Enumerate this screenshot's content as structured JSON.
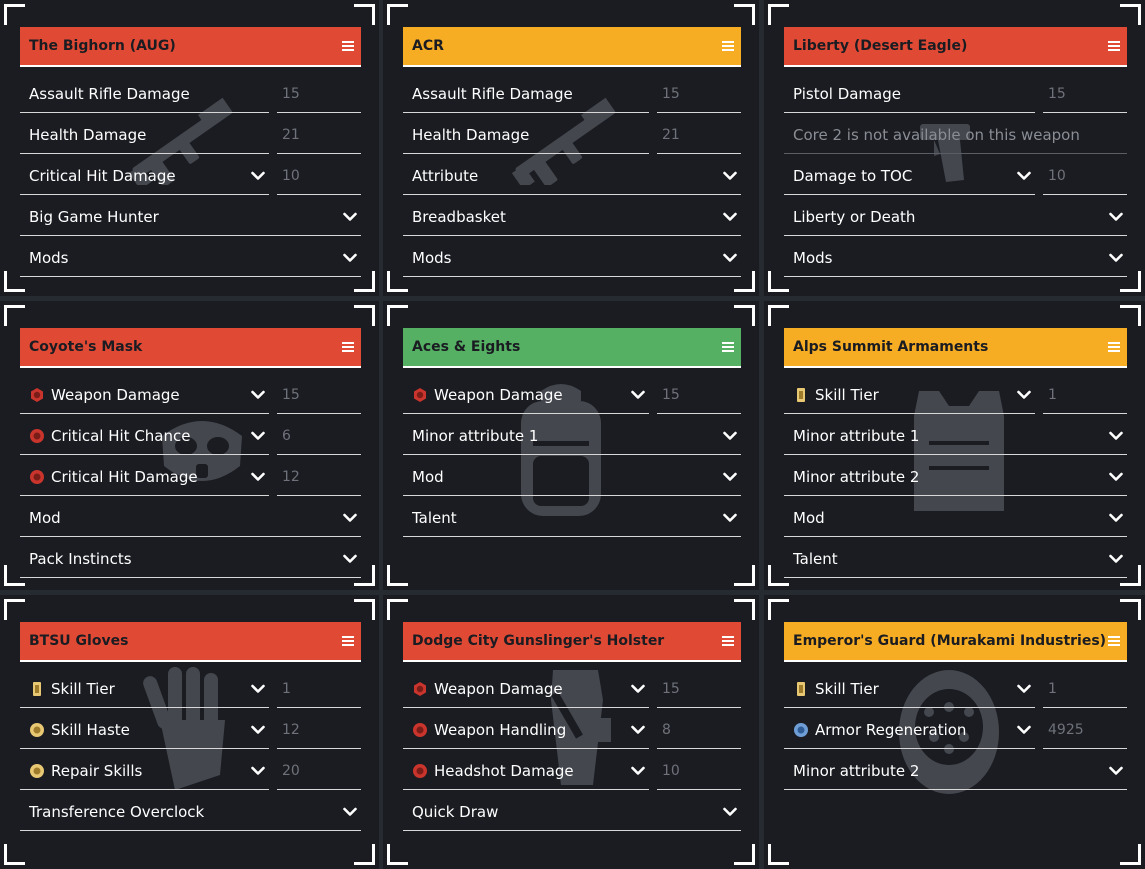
{
  "colors": {
    "red": "#e04a35",
    "yellow": "#f7ad23",
    "green": "#55b063",
    "panel": "#1a1c22",
    "background": "#262a31"
  },
  "panels": [
    {
      "title": "The Bighorn (AUG)",
      "color": "red",
      "watermark": "rifle-icon",
      "rows": [
        {
          "label": "Assault Rifle Damage",
          "value": "15"
        },
        {
          "label": "Health Damage",
          "value": "21"
        },
        {
          "label": "Critical Hit Damage",
          "value": "10",
          "dropdown": true
        },
        {
          "label": "Big Game Hunter",
          "dropdown": true
        },
        {
          "label": "Mods",
          "dropdown": true
        }
      ]
    },
    {
      "title": "ACR",
      "color": "yellow",
      "watermark": "rifle-icon",
      "rows": [
        {
          "label": "Assault Rifle Damage",
          "value": "15"
        },
        {
          "label": "Health Damage",
          "value": "21"
        },
        {
          "label": "Attribute",
          "dropdown": true
        },
        {
          "label": "Breadbasket",
          "dropdown": true
        },
        {
          "label": "Mods",
          "dropdown": true
        }
      ]
    },
    {
      "title": "Liberty (Desert Eagle)",
      "color": "red",
      "watermark": "pistol-icon",
      "rows": [
        {
          "label": "Pistol Damage",
          "value": "15"
        },
        {
          "label": "Core 2 is not available on this weapon",
          "disabled": true
        },
        {
          "label": "Damage to TOC",
          "value": "10",
          "dropdown": true
        },
        {
          "label": "Liberty or Death",
          "dropdown": true
        },
        {
          "label": "Mods",
          "dropdown": true
        }
      ]
    },
    {
      "title": "Coyote's Mask",
      "color": "red",
      "watermark": "mask-icon",
      "rows": [
        {
          "label": "Weapon Damage",
          "value": "15",
          "dropdown": true,
          "icon": "offense-core-icon"
        },
        {
          "label": "Critical Hit Chance",
          "value": "6",
          "dropdown": true,
          "icon": "offense-attribute-icon"
        },
        {
          "label": "Critical Hit Damage",
          "value": "12",
          "dropdown": true,
          "icon": "offense-attribute-icon"
        },
        {
          "label": "Mod",
          "dropdown": true
        },
        {
          "label": "Pack Instincts",
          "dropdown": true
        }
      ]
    },
    {
      "title": "Aces & Eights",
      "color": "green",
      "watermark": "backpack-icon",
      "rows": [
        {
          "label": "Weapon Damage",
          "value": "15",
          "dropdown": true,
          "icon": "offense-core-icon"
        },
        {
          "label": "Minor attribute 1",
          "dropdown": true
        },
        {
          "label": "Mod",
          "dropdown": true
        },
        {
          "label": "Talent",
          "dropdown": true
        }
      ]
    },
    {
      "title": "Alps Summit Armaments",
      "color": "yellow",
      "watermark": "vest-icon",
      "rows": [
        {
          "label": "Skill Tier",
          "value": "1",
          "dropdown": true,
          "icon": "utility-core-icon"
        },
        {
          "label": "Minor attribute 1",
          "dropdown": true
        },
        {
          "label": "Minor attribute 2",
          "dropdown": true
        },
        {
          "label": "Mod",
          "dropdown": true
        },
        {
          "label": "Talent",
          "dropdown": true
        }
      ]
    },
    {
      "title": "BTSU Gloves",
      "color": "red",
      "watermark": "glove-icon",
      "rows": [
        {
          "label": "Skill Tier",
          "value": "1",
          "dropdown": true,
          "icon": "utility-core-icon"
        },
        {
          "label": "Skill Haste",
          "value": "12",
          "dropdown": true,
          "icon": "utility-attribute-icon"
        },
        {
          "label": "Repair Skills",
          "value": "20",
          "dropdown": true,
          "icon": "utility-attribute-icon"
        },
        {
          "label": "Transference Overclock",
          "dropdown": true
        }
      ]
    },
    {
      "title": "Dodge City Gunslinger's Holster",
      "color": "red",
      "watermark": "holster-icon",
      "rows": [
        {
          "label": "Weapon Damage",
          "value": "15",
          "dropdown": true,
          "icon": "offense-core-icon"
        },
        {
          "label": "Weapon Handling",
          "value": "8",
          "dropdown": true,
          "icon": "offense-attribute-icon"
        },
        {
          "label": "Headshot Damage",
          "value": "10",
          "dropdown": true,
          "icon": "offense-attribute-icon"
        },
        {
          "label": "Quick Draw",
          "dropdown": true
        }
      ]
    },
    {
      "title": "Emperor's Guard (Murakami Industries)",
      "color": "yellow",
      "watermark": "kneepad-icon",
      "rows": [
        {
          "label": "Skill Tier",
          "value": "1",
          "dropdown": true,
          "icon": "utility-core-icon"
        },
        {
          "label": "Armor Regeneration",
          "value": "4925",
          "dropdown": true,
          "icon": "defense-attribute-icon"
        },
        {
          "label": "Minor attribute 2",
          "dropdown": true
        }
      ]
    }
  ]
}
